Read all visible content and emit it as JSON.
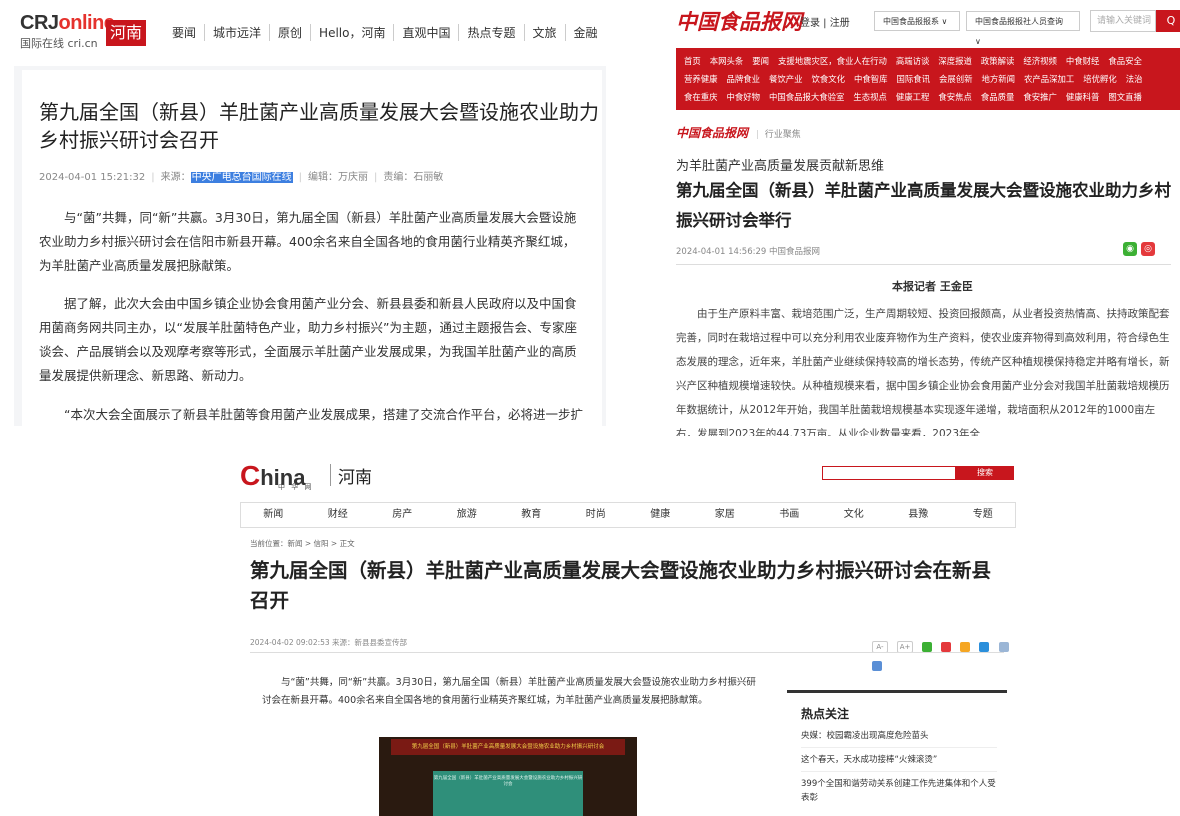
{
  "cri": {
    "logo_main_a": "CRJ",
    "logo_main_b": "online",
    "logo_sub": "国际在线 cri.cn",
    "region": "河南",
    "nav": [
      "要闻",
      "城市远洋",
      "原创",
      "Hello，河南",
      "直观中国",
      "热点专题",
      "文旅",
      "金融"
    ],
    "title": "第九届全国（新县）羊肚菌产业高质量发展大会暨设施农业助力乡村振兴研讨会召开",
    "datetime": "2024-04-01 15:21:32",
    "source_label": "来源：",
    "source_value": "中央广电总台国际在线",
    "editor": "编辑：万庆丽",
    "proof": "责编：石丽敏",
    "para1": "与“菌”共舞，同“新”共赢。3月30日，第九届全国（新县）羊肚菌产业高质量发展大会暨设施农业助力乡村振兴研讨会在信阳市新县开幕。400余名来自全国各地的食用菌行业精英齐聚红城，为羊肚菌产业高质量发展把脉献策。",
    "para2": "据了解，此次大会由中国乡镇企业协会食用菌产业分会、新县县委和新县人民政府以及中国食用菌商务网共同主办，以“发展羊肚菌特色产业，助力乡村振兴”为主题，通过主题报告会、专家座谈会、产品展销会以及观摩考察等形式，全面展示羊肚菌产业发展成果，为我国羊肚菌产业的高质量发展提供新理念、新思路、新动力。",
    "para3": "“本次大会全面展示了新县羊肚菌等食用菌产业发展成果，搭建了交流合作平台，必将进一步扩"
  },
  "cfn": {
    "logo": "中国食品报网",
    "login": "登录 | 注册",
    "dropdown1": "中国食品报报系 ∨",
    "dropdown2": "中国食品报报社人员查询 ∨",
    "search_placeholder": "请输入关键词",
    "search_button": "Q",
    "red_rows": [
      [
        "首页",
        "本网头条",
        "要闻",
        "支援地震灾区，食业人在行动",
        "高端访谈",
        "深度报道",
        "政策解读",
        "经济视频",
        "中食财经",
        "食品安全"
      ],
      [
        "营养健康",
        "品牌食业",
        "餐饮产业",
        "饮食文化",
        "中食智库",
        "国际食讯",
        "会展创新",
        "地方新闻",
        "农产品深加工",
        "培优孵化",
        "法治"
      ],
      [
        "食在重庆",
        "中食好物",
        "中国食品报大食验室",
        "生态视点",
        "健康工程",
        "食安焦点",
        "食品质量",
        "食安推广",
        "健康科普",
        "图文直播"
      ]
    ],
    "crumb_logo": "中国食品报网",
    "crumb_section": "行业聚焦",
    "subhead": "为羊肚菌产业高质量发展贡献新思维",
    "title": "第九届全国（新县）羊肚菌产业高质量发展大会暨设施农业助力乡村振兴研讨会举行",
    "meta": "2024-04-01 14:56:29 中国食品报网",
    "reporter": "本报记者 王金臣",
    "body": "由于生产原料丰富、栽培范围广泛，生产周期较短、投资回报颇高，从业者投资热情高、扶持政策配套完善，同时在栽培过程中可以充分利用农业废弃物作为生产资料，使农业废弃物得到高效利用，符合绿色生态发展的理念，近年来，羊肚菌产业继续保持较高的增长态势，传统产区种植规模保持稳定并略有增长，新兴产区种植规模增速较快。从种植规模来看，据中国乡镇企业协会食用菌产业分会对我国羊肚菌栽培规模历年数据统计，从2012年开始，我国羊肚菌栽培规模基本实现逐年递增，栽培面积从2012年的1000亩左右，发展到2023年的44.73万亩。从业企业数量来看，2023年全"
  },
  "china": {
    "logo_c": "C",
    "logo_rest": "hina",
    "logo_cn": "中 华 网",
    "region": "河南",
    "search_button": "搜索",
    "nav": [
      "新闻",
      "财经",
      "房产",
      "旅游",
      "教育",
      "时尚",
      "健康",
      "家居",
      "书画",
      "文化",
      "县豫",
      "专题"
    ],
    "crumb": "当前位置：新闻 > 信阳 > 正文",
    "title": "第九届全国（新县）羊肚菌产业高质量发展大会暨设施农业助力乡村振兴研讨会在新县召开",
    "meta": "2024-04-02 09:02:53 来源：新县县委宣传部",
    "font_small": "A-",
    "font_large": "A+",
    "body": "与“菌”共舞，同“新”共赢。3月30日，第九届全国（新县）羊肚菌产业高质量发展大会暨设施农业助力乡村振兴研讨会在新县开幕。400余名来自全国各地的食用菌行业精英齐聚红城，为羊肚菌产业高质量发展把脉献策。",
    "photo_banner": "第九届全国（新县）羊肚菌产业高质量发展大会暨设施农业助力乡村振兴研讨会",
    "hot_title": "热点关注",
    "hot_items": [
      "央媒：校园霸凌出现高度危险苗头",
      "这个春天，天水成功接棒“火辣滚烫”",
      "399个全国和谐劳动关系创建工作先进集体和个人受表彰"
    ]
  }
}
